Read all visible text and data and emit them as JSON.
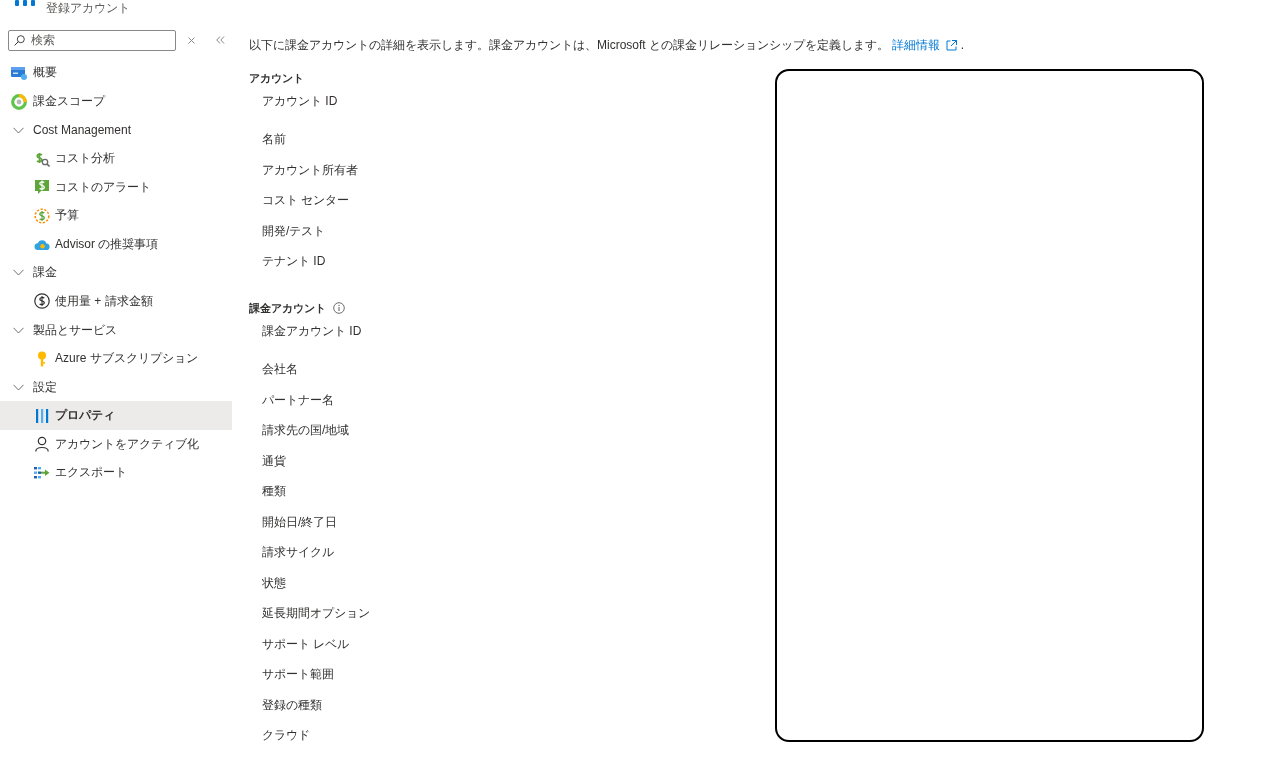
{
  "header": {
    "title": "登録アカウント"
  },
  "sidebar": {
    "search": {
      "placeholder": "検索"
    },
    "items": [
      {
        "kind": "link",
        "label": "概要",
        "selected": false
      },
      {
        "kind": "link",
        "label": "課金スコープ",
        "selected": false
      },
      {
        "kind": "group",
        "label": "Cost Management",
        "expanded": true,
        "children": [
          {
            "kind": "link",
            "label": "コスト分析",
            "selected": false
          },
          {
            "kind": "link",
            "label": "コストのアラート",
            "selected": false
          },
          {
            "kind": "link",
            "label": "予算",
            "selected": false
          },
          {
            "kind": "link",
            "label": "Advisor の推奨事項",
            "selected": false
          }
        ]
      },
      {
        "kind": "group",
        "label": "課金",
        "expanded": true,
        "children": [
          {
            "kind": "link",
            "label": "使用量 + 請求金額",
            "selected": false
          }
        ]
      },
      {
        "kind": "group",
        "label": "製品とサービス",
        "expanded": true,
        "children": [
          {
            "kind": "link",
            "label": "Azure サブスクリプション",
            "selected": false
          }
        ]
      },
      {
        "kind": "group",
        "label": "設定",
        "expanded": true,
        "children": [
          {
            "kind": "link",
            "label": "プロパティ",
            "selected": true
          },
          {
            "kind": "link",
            "label": "アカウントをアクティブ化",
            "selected": false
          },
          {
            "kind": "link",
            "label": "エクスポート",
            "selected": false
          }
        ]
      }
    ]
  },
  "main": {
    "description": "以下に課金アカウントの詳細を表示します。課金アカウントは、Microsoft との課金リレーションシップを定義します。",
    "link": "詳細情報",
    "trailing": ".",
    "sections": [
      {
        "title": "アカウント",
        "info": false,
        "fields": [
          "アカウント ID",
          "名前",
          "アカウント所有者",
          "コスト センター",
          "開発/テスト",
          "テナント ID"
        ]
      },
      {
        "title": "課金アカウント",
        "info": true,
        "fields": [
          "課金アカウント ID",
          "会社名",
          "パートナー名",
          "請求先の国/地域",
          "通貨",
          "種類",
          "開始日/終了日",
          "請求サイクル",
          "状態",
          "延長期間オプション",
          "サポート レベル",
          "サポート範囲",
          "登録の種類",
          "クラウド"
        ]
      }
    ]
  }
}
